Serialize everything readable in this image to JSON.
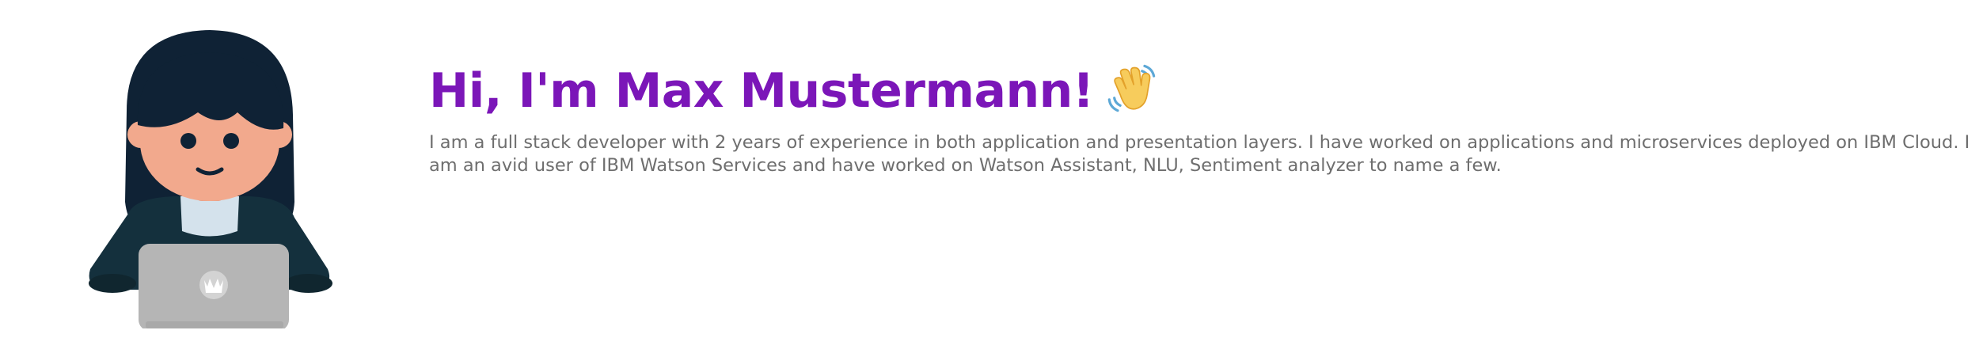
{
  "hero": {
    "greeting": "Hi, I'm Max Mustermann!",
    "bio": "I am a full stack developer with 2 years of experience in both application and presentation layers. I have worked on applications and microservices deployed on IBM Cloud. I am an avid user of IBM Watson Services and have worked on Watson Assistant, NLU, Sentiment analyzer to name a few.",
    "greeting_color": "#7b16b8",
    "bio_color": "#6e6e6e"
  },
  "icons": {
    "avatar": "developer-avatar-illustration",
    "wave": "waving-hand-icon"
  }
}
